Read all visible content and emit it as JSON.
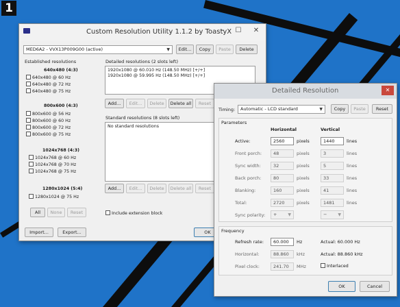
{
  "badge": "1",
  "cru": {
    "title": "Custom Resolution Utility 1.1.2 by ToastyX",
    "monitor_select": "MED6A2 - VVX13P009G00 (active)",
    "top_buttons": {
      "edit": "Edit...",
      "copy": "Copy",
      "paste": "Paste",
      "delete": "Delete"
    },
    "established": {
      "heading": "Established resolutions",
      "groups": [
        {
          "title": "640x480 (4:3)",
          "items": [
            "640x480 @ 60 Hz",
            "640x480 @ 72 Hz",
            "640x480 @ 75 Hz"
          ]
        },
        {
          "title": "800x600 (4:3)",
          "items": [
            "800x600 @ 56 Hz",
            "800x600 @ 60 Hz",
            "800x600 @ 72 Hz",
            "800x600 @ 75 Hz"
          ]
        },
        {
          "title": "1024x768 (4:3)",
          "items": [
            "1024x768 @ 60 Hz",
            "1024x768 @ 70 Hz",
            "1024x768 @ 75 Hz"
          ]
        },
        {
          "title": "1280x1024 (5:4)",
          "items": [
            "1280x1024 @ 75 Hz"
          ]
        }
      ],
      "buttons": {
        "all": "All",
        "none": "None",
        "reset": "Reset"
      }
    },
    "detailed": {
      "heading": "Detailed resolutions (2 slots left)",
      "rows": [
        "1920x1080 @ 60.010 Hz (148.50 MHz) [+/+]",
        "1920x1080 @ 59.995 Hz (148.50 MHz) [+/+]"
      ],
      "buttons": {
        "add": "Add...",
        "edit": "Edit...",
        "delete": "Delete",
        "delete_all": "Delete all",
        "reset": "Reset"
      }
    },
    "standard": {
      "heading": "Standard resolutions (8 slots left)",
      "rows": [
        "No standard resolutions"
      ],
      "buttons": {
        "add": "Add...",
        "edit": "Edit...",
        "delete": "Delete",
        "delete_all": "Delete all",
        "reset": "Reset"
      }
    },
    "extension_label": "Include extension block",
    "bottom_buttons": {
      "import": "Import...",
      "export": "Export...",
      "ok": "OK"
    }
  },
  "detail": {
    "title": "Detailed Resolution",
    "close_glyph": "✕",
    "timing_label": "Timing:",
    "timing_value": "Automatic - LCD standard",
    "buttons": {
      "copy": "Copy",
      "paste": "Paste",
      "reset": "Reset"
    },
    "params_label": "Parameters",
    "col_horizontal": "Horizontal",
    "col_vertical": "Vertical",
    "rows": [
      {
        "label": "Active:",
        "h": "2560",
        "hu": "pixels",
        "v": "1440",
        "vu": "lines"
      },
      {
        "label": "Front porch:",
        "h": "48",
        "hu": "pixels",
        "v": "3",
        "vu": "lines"
      },
      {
        "label": "Sync width:",
        "h": "32",
        "hu": "pixels",
        "v": "5",
        "vu": "lines"
      },
      {
        "label": "Back porch:",
        "h": "80",
        "hu": "pixels",
        "v": "33",
        "vu": "lines"
      },
      {
        "label": "Blanking:",
        "h": "160",
        "hu": "pixels",
        "v": "41",
        "vu": "lines"
      },
      {
        "label": "Total:",
        "h": "2720",
        "hu": "pixels",
        "v": "1481",
        "vu": "lines"
      }
    ],
    "sync_polarity_label": "Sync polarity:",
    "sync_h": "+",
    "sync_v": "−",
    "frequency_label": "Frequency",
    "refresh_label": "Refresh rate:",
    "refresh_value": "60.000",
    "refresh_unit": "Hz",
    "refresh_actual": "Actual: 60.000 Hz",
    "horizontal_label": "Horizontal:",
    "horizontal_value": "88.860",
    "horizontal_unit": "kHz",
    "horizontal_actual": "Actual: 88.860 kHz",
    "pixelclock_label": "Pixel clock:",
    "pixelclock_value": "241.70",
    "pixelclock_unit": "MHz",
    "interlaced_label": "Interlaced",
    "ok": "OK",
    "cancel": "Cancel"
  }
}
